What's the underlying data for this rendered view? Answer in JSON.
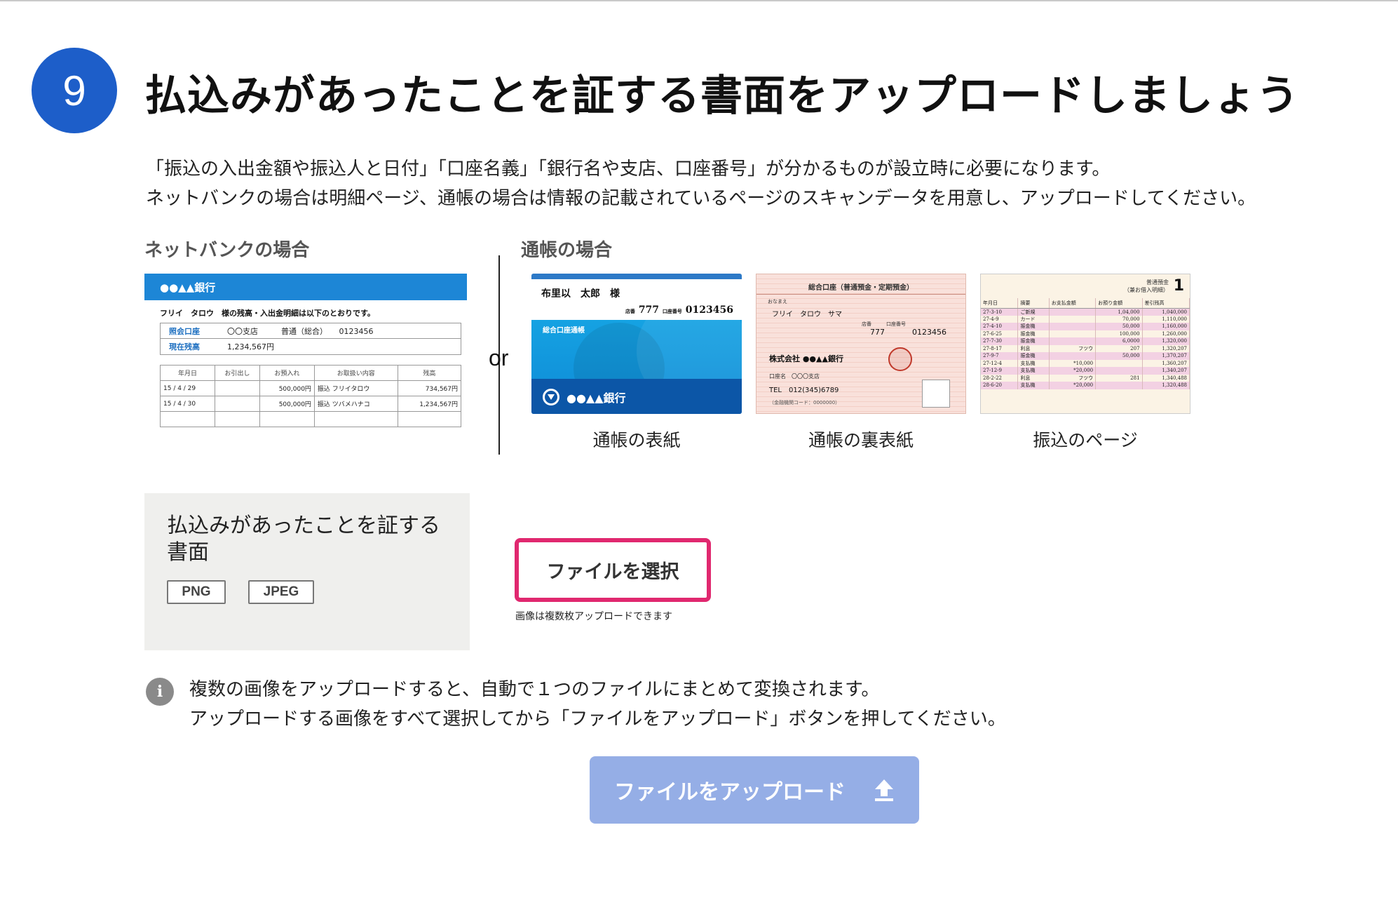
{
  "step": {
    "number": "9",
    "title": "払込みがあったことを証する書面をアップロードしましょう"
  },
  "description": {
    "line1": "「振込の入出金額や振込人と日付」「口座名義」「銀行名や支店、口座番号」が分かるものが設立時に必要になります。",
    "line2": "ネットバンクの場合は明細ページ、通帳の場合は情報の記載されているページのスキャンデータを用意し、アップロードしてください。"
  },
  "examples": {
    "netbank_label": "ネットバンクの場合",
    "or_label": "or",
    "passbook_label": "通帳の場合",
    "netbank_sample": {
      "bank_name": "●●▲▲銀行",
      "greeting": "フリイ　タロウ　様の残高・入出金明細は以下のとおりです。",
      "account_key": "照会口座",
      "account_value": "〇〇支店　　　普通（総合）　　0123456",
      "balance_key": "現在残高",
      "balance_value": "1,234,567円",
      "headers": [
        "年月日",
        "お引出し",
        "お預入れ",
        "お取扱い内容",
        "残高"
      ],
      "rows": [
        [
          "15 / 4 / 29",
          "",
          "500,000円",
          "振込 フリイタロウ",
          "734,567円"
        ],
        [
          "15 / 4 / 30",
          "",
          "500,000円",
          "振込 ツバメハナコ",
          "1,234,567円"
        ],
        [
          "",
          "",
          "",
          "",
          ""
        ]
      ]
    },
    "front_sample": {
      "name": "布里以　太郎　様",
      "shop_label": "店番",
      "shop_no": "777",
      "account_label": "口座番号",
      "account_no": "0123456",
      "type": "総合口座通帳",
      "bank": "●●▲▲銀行"
    },
    "back_sample": {
      "title": "総合口座（普通預金・定期預金）",
      "name_label": "おなまえ",
      "kana": "フリイ　タロウ　サマ",
      "shop_label": "店番　　　口座番号",
      "shop_no": "777",
      "account_no": "0123456",
      "company": "株式会社 ●●▲▲銀行",
      "branch": "口座名　〇〇〇支店",
      "tel": "TEL　012(345)6789",
      "code": "（金融機関コード：0000000）"
    },
    "page_sample": {
      "head": "普通預金\n（兼お借入明細）",
      "page_no": "1",
      "headers": [
        "年月日",
        "摘要",
        "お支払金額",
        "お預り金額",
        "差引残高"
      ],
      "rows": [
        [
          "27-3-10",
          "ご新規",
          "",
          "1,04,000",
          "1,040,000"
        ],
        [
          "27-4-9",
          "カード",
          "",
          "70,000",
          "1,110,000"
        ],
        [
          "27-4-10",
          "振金機",
          "",
          "50,000",
          "1,160,000"
        ],
        [
          "27-6-25",
          "振金機",
          "",
          "100,000",
          "1,260,000"
        ],
        [
          "27-7-30",
          "振金機",
          "",
          "6,0000",
          "1,320,000"
        ],
        [
          "27-8-17",
          "利息",
          "フツウ",
          "207",
          "1,320,207"
        ],
        [
          "27-9-7",
          "振金機",
          "",
          "50,000",
          "1,370,207"
        ],
        [
          "27-12-4",
          "支払機",
          "*10,000",
          "",
          "1,360,207"
        ],
        [
          "27-12-9",
          "支払機",
          "*20,000",
          "",
          "1,340,207"
        ],
        [
          "28-2-22",
          "利息",
          "フツウ",
          "281",
          "1,340,488"
        ],
        [
          "28-6-20",
          "支払機",
          "*20,000",
          "",
          "1,320,488"
        ]
      ]
    },
    "captions": [
      "通帳の表紙",
      "通帳の裏表紙",
      "振込のページ"
    ]
  },
  "upload": {
    "field_label": "払込みがあったことを証する書面",
    "formats": [
      "PNG",
      "JPEG"
    ],
    "select_button": "ファイルを選択",
    "multi_note": "画像は複数枚アップロードできます"
  },
  "info": {
    "icon": "info-icon",
    "line1": "複数の画像をアップロードすると、自動で１つのファイルにまとめて変換されます。",
    "line2": "アップロードする画像をすべて選択してから「ファイルをアップロード」ボタンを押してください。"
  },
  "submit": {
    "label": "ファイルをアップロード",
    "icon": "upload-icon"
  },
  "colors": {
    "step_circle": "#1d5ec9",
    "select_border": "#e0286f",
    "upload_button": "#95aee6",
    "panel_bg": "#efefed"
  }
}
